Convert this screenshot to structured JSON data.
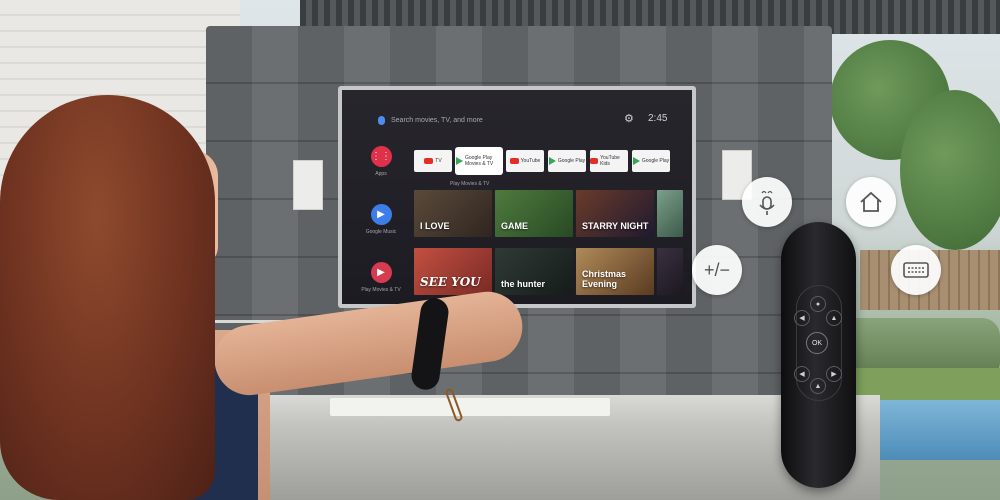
{
  "tv": {
    "search_placeholder": "Search movies, TV, and more",
    "time": "2:45",
    "side_apps": [
      {
        "label": "Apps",
        "color": "#e0314b",
        "glyph": "⋮⋮"
      },
      {
        "label": "Google Music",
        "color": "#3d7de8",
        "glyph": "▶"
      },
      {
        "label": "Play Movies & TV",
        "color": "#d63b4f",
        "glyph": "▶"
      }
    ],
    "app_row": [
      {
        "name": "TV",
        "badge": "yt"
      },
      {
        "name": "Google Play Movies & TV",
        "badge": "gp",
        "focused": true
      },
      {
        "name": "YouTube",
        "badge": "yt"
      },
      {
        "name": "Google Play",
        "badge": "gp"
      },
      {
        "name": "YouTube Kids",
        "badge": "yt"
      },
      {
        "name": "Google Play",
        "badge": "gp"
      }
    ],
    "focused_label": "Play Movies & TV",
    "thumbnails_row1": [
      {
        "text": "I LOVE",
        "from": "#5b4a3a",
        "to": "#2f2620"
      },
      {
        "text": "GAME",
        "from": "#4f7a3e",
        "to": "#284a24"
      },
      {
        "text": "STARRY NIGHT",
        "from": "#6b3b2a",
        "to": "#1f1a30"
      },
      {
        "text": "",
        "from": "#7aa08a",
        "to": "#3d5a4a"
      }
    ],
    "thumbnails_row2": [
      {
        "text": "SEE YOU",
        "from": "#c25040",
        "to": "#7a2a26"
      },
      {
        "text": "the hunter",
        "from": "#2f3a36",
        "to": "#151c1a"
      },
      {
        "text": "Christmas Evening",
        "from": "#b08a58",
        "to": "#5a3b22"
      },
      {
        "text": "",
        "from": "#3a3040",
        "to": "#1c1820"
      }
    ]
  },
  "features": {
    "voice": "voice-mic-icon",
    "home": "home-icon",
    "volume": "volume-plus-minus-icon",
    "keyboard": "keyboard-icon",
    "volume_symbol": "+/−"
  },
  "remote": {
    "ok_label": "OK"
  }
}
